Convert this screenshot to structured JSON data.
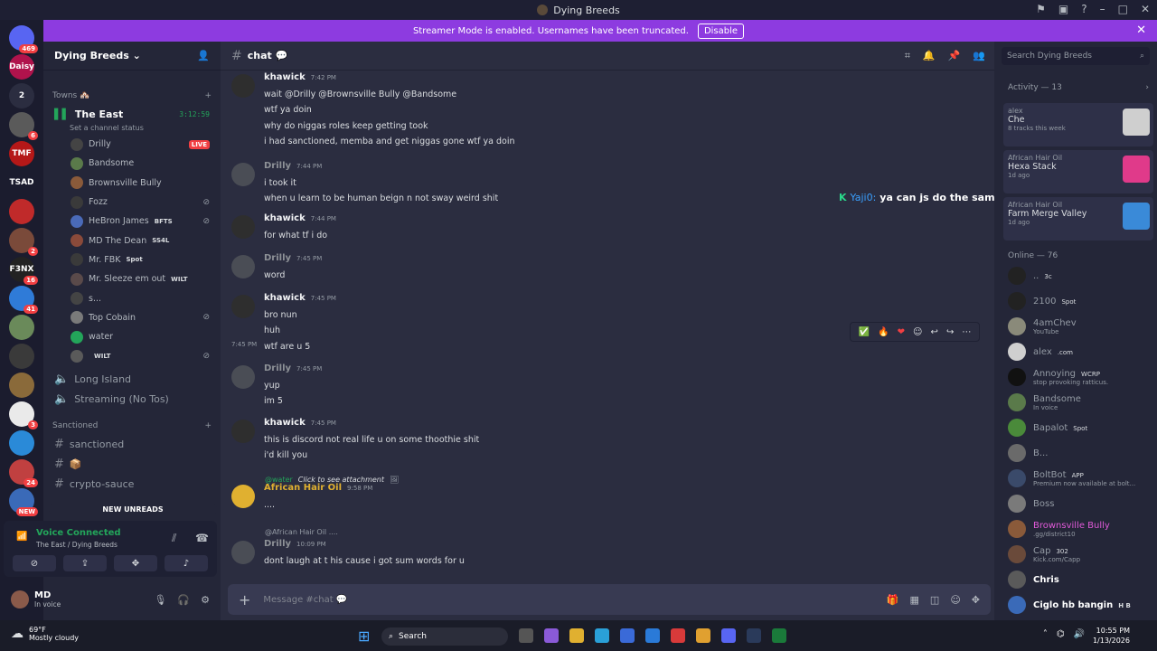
{
  "window": {
    "title": "Dying Breeds"
  },
  "banner": {
    "text": "Streamer Mode is enabled. Usernames have been truncated.",
    "button": "Disable"
  },
  "guilds": [
    {
      "label": "",
      "badge": "469",
      "color": "#5865f2"
    },
    {
      "label": "Daisy",
      "badge": "",
      "color": "#b0134c"
    },
    {
      "label": "2",
      "badge": "",
      "color": "#2b2d40"
    },
    {
      "label": "",
      "badge": "6",
      "color": "#5a5a5a"
    },
    {
      "label": "TMF",
      "badge": "",
      "color": "#b51818"
    },
    {
      "label": "TSAD",
      "badge": "",
      "color": "#1b1c2e"
    },
    {
      "label": "",
      "badge": "",
      "color": "#c02a2a"
    },
    {
      "label": "",
      "badge": "2",
      "color": "#7a4a3a"
    },
    {
      "label": "F3NX",
      "badge": "16",
      "color": "#222"
    },
    {
      "label": "",
      "badge": "41",
      "color": "#2f7bd8"
    },
    {
      "label": "",
      "badge": "",
      "color": "#6a8a5a"
    },
    {
      "label": "",
      "badge": "",
      "color": "#3a3a3a"
    },
    {
      "label": "",
      "badge": "",
      "color": "#8a6a3a"
    },
    {
      "label": "",
      "badge": "3",
      "color": "#eaeaea"
    },
    {
      "label": "",
      "badge": "",
      "color": "#2a8ad8"
    },
    {
      "label": "",
      "badge": "24",
      "color": "#c04040"
    },
    {
      "label": "",
      "badge": "NEW",
      "color": "#3a6ab8"
    }
  ],
  "sidebar": {
    "server_name": "Dying Breeds",
    "cat_towns": "Towns 🏘️",
    "voice_channel": {
      "name": "The East",
      "timer": "3:12:59",
      "status": "Set a channel status"
    },
    "voice_users": [
      {
        "name": "Drilly",
        "tag": "",
        "live": "LIVE",
        "muted": false,
        "color": "#444"
      },
      {
        "name": "Bandsome",
        "tag": "",
        "live": "",
        "muted": false,
        "color": "#5a7a4a"
      },
      {
        "name": "Brownsville Bully",
        "tag": "",
        "live": "",
        "muted": false,
        "color": "#8a5a3a"
      },
      {
        "name": "Fozz",
        "tag": "",
        "live": "",
        "muted": true,
        "color": "#3a3a3a"
      },
      {
        "name": "HeBron James",
        "tag": "BFTS",
        "live": "",
        "muted": true,
        "color": "#4a6ab8"
      },
      {
        "name": "MD The Dean",
        "tag": "SS4L",
        "live": "",
        "muted": false,
        "color": "#8a4a3a"
      },
      {
        "name": "Mr. FBK",
        "tag": "Spot",
        "live": "",
        "muted": false,
        "color": "#3a3a3a"
      },
      {
        "name": "Mr. Sleeze em out",
        "tag": "WILT",
        "live": "",
        "muted": false,
        "color": "#5a4a4a"
      },
      {
        "name": "s...",
        "tag": "",
        "live": "",
        "muted": false,
        "color": "#444"
      },
      {
        "name": "Top Cobain",
        "tag": "",
        "live": "",
        "muted": true,
        "color": "#7a7a7a"
      },
      {
        "name": "water",
        "tag": "",
        "live": "",
        "muted": false,
        "color": "#23a55a"
      },
      {
        "name": "",
        "tag": "WILT",
        "live": "",
        "muted": true,
        "color": "#5a5a5a"
      }
    ],
    "other_voice": [
      "Long Island",
      "Streaming (No Tos)"
    ],
    "cat_sanctioned": "Sanctioned",
    "text_channels": [
      "sanctioned",
      "📦",
      "crypto-sauce"
    ],
    "new_unreads": "NEW UNREADS",
    "voice_panel": {
      "title": "Voice Connected",
      "sub": "The East / Dying Breeds"
    },
    "user": {
      "name": "MD",
      "status": "In voice"
    }
  },
  "channel": {
    "name": "chat 💬"
  },
  "messages": [
    {
      "author": "khawick",
      "time": "7:42 PM",
      "lines": [
        "wait @Drilly @Brownsville Bully @Bandsome",
        "wtf ya doin",
        "why do niggas roles keep getting took",
        "i had sanctioned, memba and get niggas gone wtf ya doin"
      ]
    },
    {
      "author": "Drilly",
      "time": "7:44 PM",
      "lines": [
        "i took it",
        "when u learn to be human beign n not sway weird shit"
      ]
    },
    {
      "author": "khawick",
      "time": "7:44 PM",
      "lines": [
        "for what tf i do"
      ]
    },
    {
      "author": "Drilly",
      "time": "7:45 PM",
      "lines": [
        "word"
      ]
    },
    {
      "author": "khawick",
      "time": "7:45 PM",
      "lines": [
        "bro nun",
        "huh",
        "wtf are u 5"
      ]
    },
    {
      "author": "Drilly",
      "time": "7:45 PM",
      "lines": [
        "yup",
        "im 5"
      ]
    },
    {
      "author": "khawick",
      "time": "7:45 PM",
      "lines": [
        "this is discord not real life u on some thoothie shit",
        "i'd kill you"
      ]
    },
    {
      "author": "African Hair Oil",
      "time": "9:58 PM",
      "lines": [
        "...."
      ]
    },
    {
      "author": "Drilly",
      "time": "10:09 PM",
      "lines": [
        "dont laugh at t his  cause i got sum words for u"
      ]
    }
  ],
  "side_time": "7:45 PM",
  "reply1": {
    "who": "@water",
    "text": "Click to see attachment"
  },
  "reply2": {
    "who": "@African Hair Oil ...."
  },
  "composer": {
    "placeholder": "Message #chat 💬"
  },
  "overlay": {
    "user": "Yaji0:",
    "text": "ya can js do the same shi ya was doin"
  },
  "members": {
    "search_placeholder": "Search Dying Breeds",
    "activity_head": "Activity — 13",
    "activities": [
      {
        "who": "alex",
        "what": "Che",
        "meta": "8 tracks this week",
        "color": "#cfcfcf"
      },
      {
        "who": "African Hair Oil",
        "what": "Hexa Stack",
        "meta": "1d ago",
        "color": "#e03a8a"
      },
      {
        "who": "African Hair Oil",
        "what": "Farm Merge Valley",
        "meta": "1d ago",
        "color": "#3a8ad8"
      }
    ],
    "online_head": "Online — 76",
    "online": [
      {
        "name": "..",
        "status": "",
        "tag": "3c",
        "color": "#222"
      },
      {
        "name": "2100",
        "status": "",
        "tag": "Spot",
        "color": "#222"
      },
      {
        "name": "4amChev",
        "status": "YouTube",
        "tag": "",
        "color": "#8a8a7a"
      },
      {
        "name": "alex",
        "status": "",
        "tag": ".com",
        "color": "#cfcfcf"
      },
      {
        "name": "Annoying",
        "status": "stop provoking ratticus.",
        "tag": "WCRP",
        "color": "#111"
      },
      {
        "name": "Bandsome",
        "status": "In voice",
        "tag": "",
        "color": "#5a7a4a"
      },
      {
        "name": "Bapalot",
        "status": "",
        "tag": "Spot",
        "color": "#4a8a3a"
      },
      {
        "name": "B...",
        "status": "",
        "tag": "",
        "color": "#6a6a6a"
      },
      {
        "name": "BoltBot",
        "status": "Premium now available at bolt...",
        "tag": "APP",
        "color": "#3a4a6a"
      },
      {
        "name": "Boss",
        "status": "",
        "tag": "",
        "color": "#7a7a7a"
      },
      {
        "name": "Brownsville Bully",
        "status": ".gg/district10",
        "tag": "",
        "color": "#8a5a3a"
      },
      {
        "name": "Cap",
        "status": "Kick.com/Capp",
        "tag": "302",
        "color": "#6a4a3a"
      },
      {
        "name": "Chris",
        "status": "",
        "tag": "",
        "color": "#5a5a5a"
      },
      {
        "name": "Ciglo hb bangin",
        "status": "",
        "tag": "H B",
        "color": "#3a6ab8"
      }
    ]
  },
  "taskbar": {
    "temp": "69°F",
    "weather": "Mostly cloudy",
    "search": "Search",
    "time": "10:55 PM",
    "date": "1/13/2026"
  }
}
